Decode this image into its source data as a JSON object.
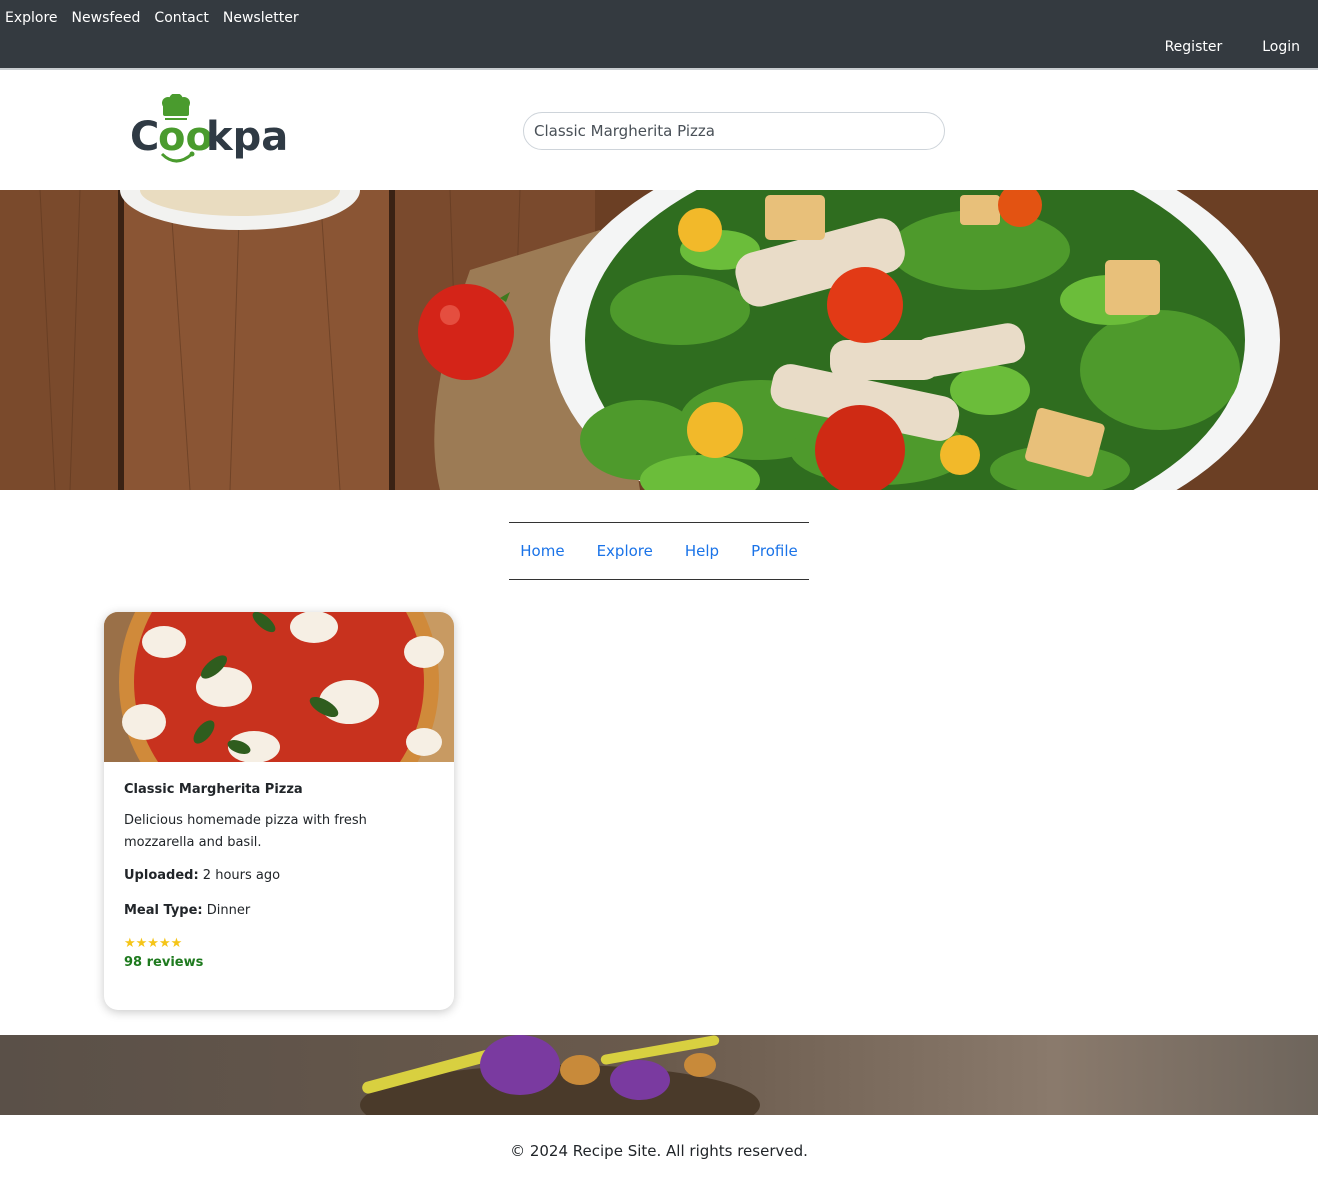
{
  "topbar": {
    "left_links": [
      "Explore",
      "Newsfeed",
      "Contact",
      "Newsletter"
    ],
    "right_links": [
      "Register",
      "Login"
    ],
    "bg_color": "#343a40"
  },
  "header": {
    "logo_text_main": "Cookpal",
    "search": {
      "value": "Classic Margherita Pizza"
    }
  },
  "subnav": {
    "items": [
      "Home",
      "Explore",
      "Help",
      "Profile"
    ],
    "link_color": "#1a73e8"
  },
  "card": {
    "title": "Classic Margherita Pizza",
    "description": "Delicious homemade pizza with fresh mozzarella and basil.",
    "uploaded_label": "Uploaded:",
    "uploaded_value": "2 hours ago",
    "meal_type_label": "Meal Type:",
    "meal_type_value": "Dinner",
    "stars": "★★★★★",
    "rating": 5,
    "reviews": "98 reviews"
  },
  "footer": {
    "copyright": "© 2024 Recipe Site. All rights reserved."
  },
  "icons": [
    "chef-hat-icon",
    "star-icon"
  ]
}
